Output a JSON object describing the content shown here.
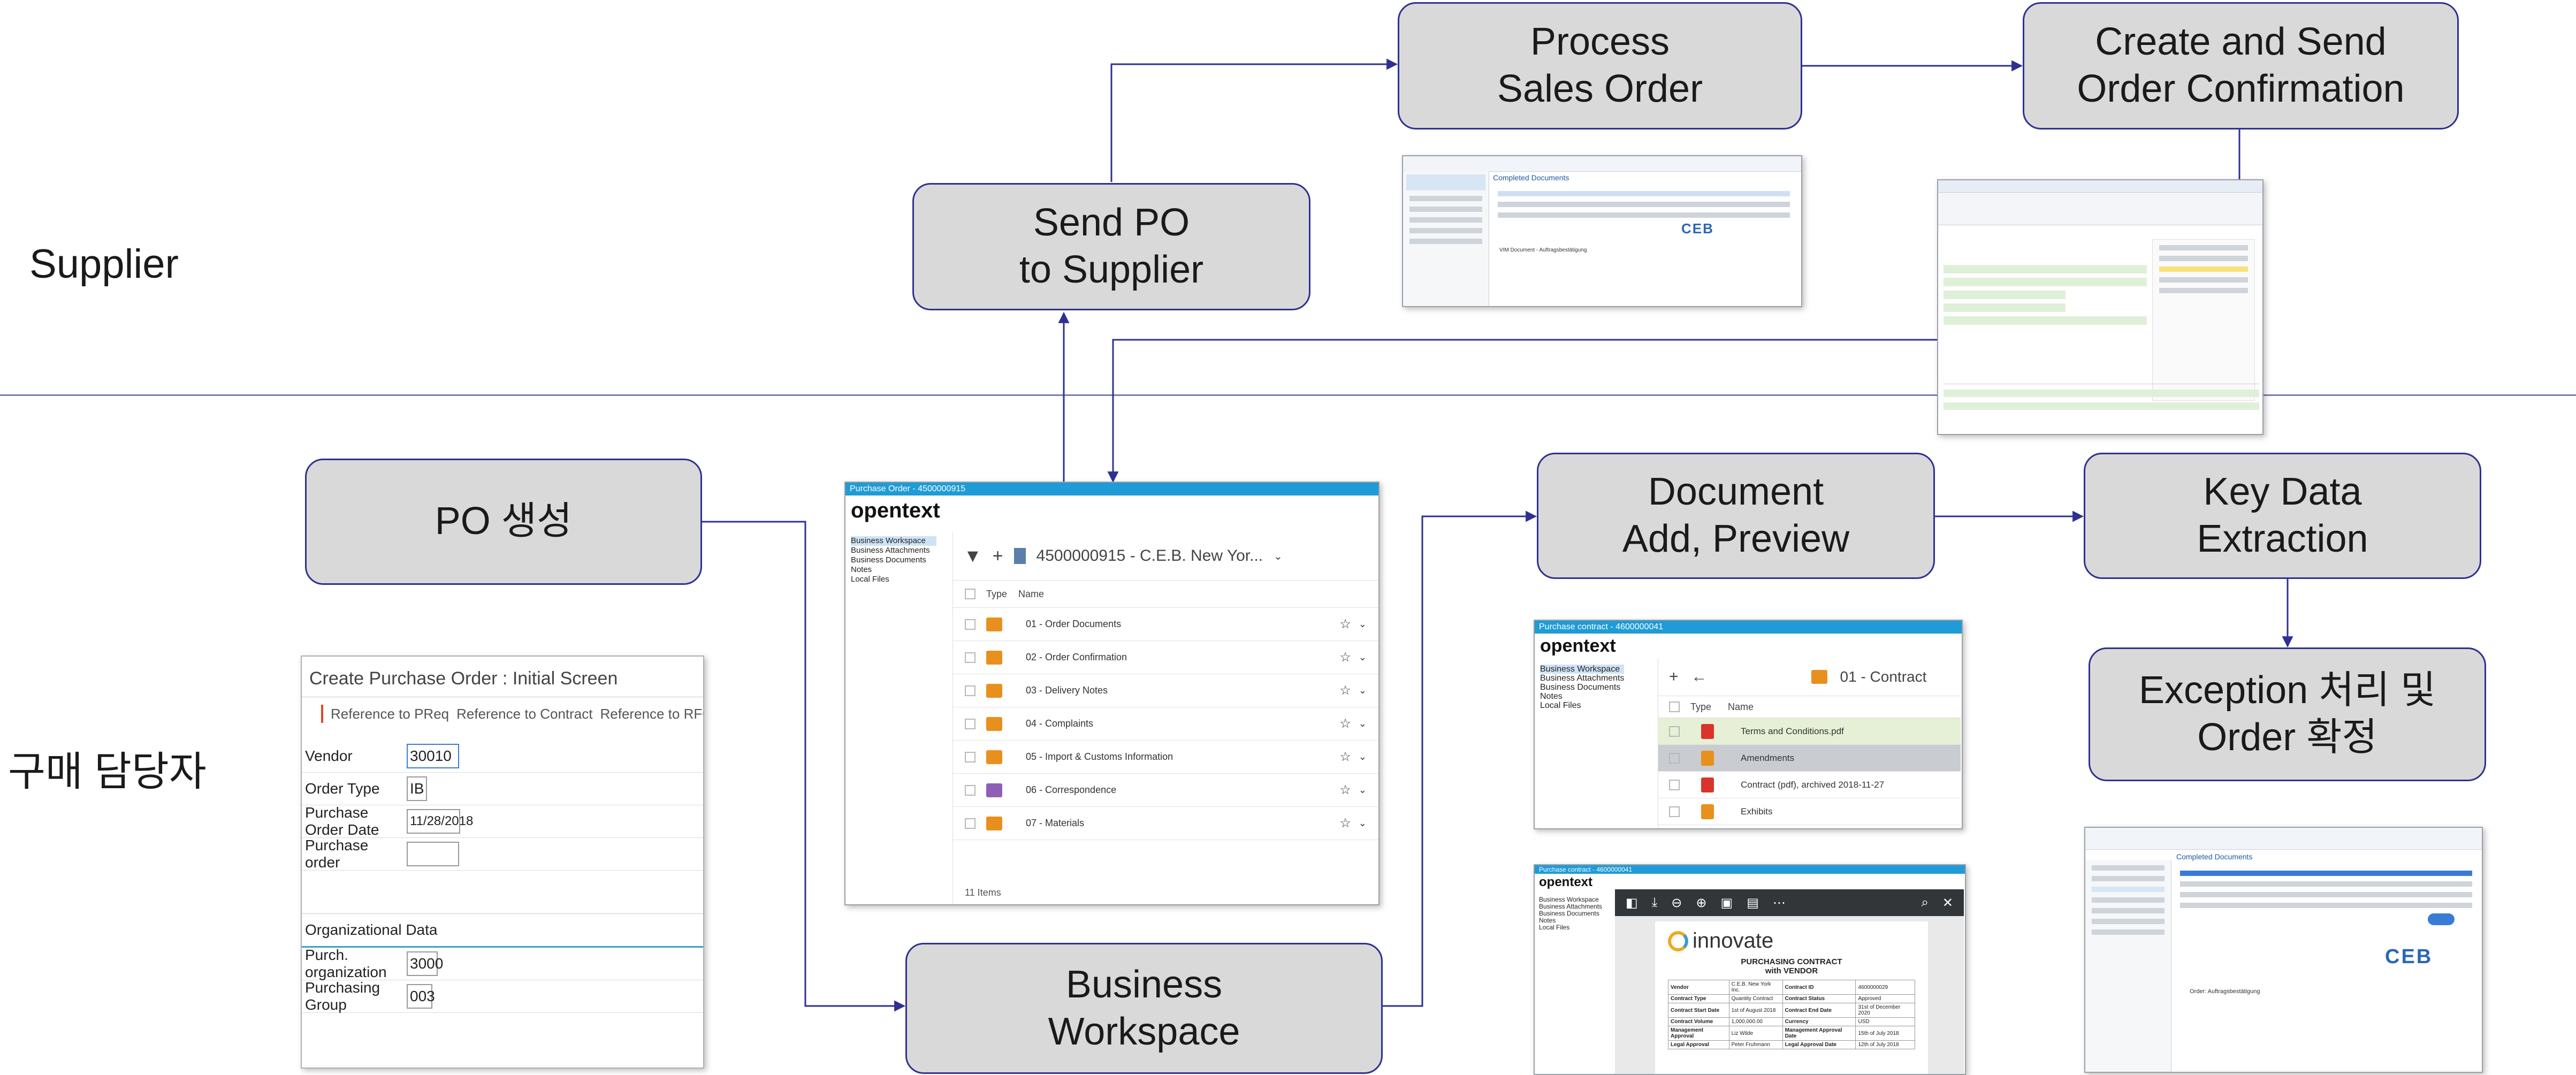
{
  "lanes": {
    "supplier": "Supplier",
    "buyer": "구매 담당자"
  },
  "steps": {
    "process_sales_order": [
      "Process",
      "Sales Order"
    ],
    "create_send_confirmation": [
      "Create and Send",
      "Order Confirmation"
    ],
    "send_po": [
      "Send PO",
      "to Supplier"
    ],
    "po_create": [
      "PO 생성"
    ],
    "document_add": [
      "Document",
      "Add, Preview"
    ],
    "key_data": [
      "Key Data",
      "Extraction"
    ],
    "exception": [
      "Exception 처리 및",
      "Order 확정"
    ],
    "business_workspace": [
      "Business",
      "Workspace"
    ]
  },
  "screens": {
    "sap_po": {
      "title": "Create Purchase Order : Initial Screen",
      "toolbar": [
        "Reference to PReq",
        "Reference to Contract",
        "Reference to RFQ"
      ],
      "fields": [
        {
          "label": "Vendor",
          "value": "30010"
        },
        {
          "label": "Order Type",
          "value": "IB"
        },
        {
          "label": "Purchase Order Date",
          "value": "11/28/2018"
        },
        {
          "label": "Purchase order",
          "value": ""
        }
      ],
      "org_section": "Organizational Data",
      "org_fields": [
        {
          "label": "Purch. organization",
          "value": "3000"
        },
        {
          "label": "Purchasing Group",
          "value": "003"
        }
      ]
    },
    "workspace": {
      "window_title": "Purchase Order - 4500000915",
      "logo": "opentext",
      "tree": [
        "Business Workspace",
        "Business Attachments",
        "Business Documents",
        "Notes",
        "Local Files"
      ],
      "breadcrumb": "4500000915 - C.E.B. New Yor...",
      "col_type": "Type",
      "col_name": "Name",
      "rows": [
        "01 - Order Documents",
        "02 - Order Confirmation",
        "03 - Delivery Notes",
        "04 - Complaints",
        "05 - Import & Customs Information",
        "06 - Correspondence",
        "07 - Materials"
      ],
      "footer": "11 Items"
    },
    "contract": {
      "window_title": "Purchase contract - 4600000041",
      "logo": "opentext",
      "tree": [
        "Business Workspace",
        "Business Attachments",
        "Business Documents",
        "Notes",
        "Local Files"
      ],
      "folder": "01 - Contract",
      "col_type": "Type",
      "col_name": "Name",
      "rows": [
        "Terms and Conditions.pdf",
        "Amendments",
        "Contract (pdf), archived 2018-11-27",
        "Exhibits"
      ]
    },
    "preview": {
      "window_title": "Purchase contract - 4600000041",
      "logo": "opentext",
      "tree": [
        "Business Workspace",
        "Business Attachments",
        "Business Documents",
        "Notes",
        "Local Files"
      ],
      "brand": "innovate",
      "doc_title": "PURCHASING CONTRACT",
      "doc_subtitle": "with VENDOR",
      "table": [
        [
          "Vendor",
          "C.E.B. New York Inc.",
          "Contract ID",
          "4600000029"
        ],
        [
          "Contract Type",
          "Quantity Contract",
          "Contract Status",
          "Approved"
        ],
        [
          "Contract Start Date",
          "1st of August 2018",
          "Contract End Date",
          "31st of December 2020"
        ],
        [
          "Contract Volume",
          "1,000,000.00",
          "Currency",
          "USD"
        ],
        [
          "Management Approval",
          "Liz Wilde",
          "Management Approval Date",
          "15th of July 2018"
        ],
        [
          "Legal Approval",
          "Peter Fruhmann",
          "Legal Approval Date",
          "12th of July 2018"
        ]
      ]
    },
    "sales_order": {
      "heading": "Completed Documents",
      "letter_title": "VIM Document - Auftragsbestätigung"
    },
    "exception_screen": {
      "heading": "Completed Documents",
      "letter_title": "Order: Auftragsbestätigung",
      "logo": "CEB"
    }
  },
  "colors": {
    "box_fill": "#d9d9d9",
    "box_border": "#2e3192",
    "connector": "#2e3192",
    "titlebar": "#1f9bd7",
    "folder": "#e8901e",
    "pdf": "#d9342b"
  }
}
